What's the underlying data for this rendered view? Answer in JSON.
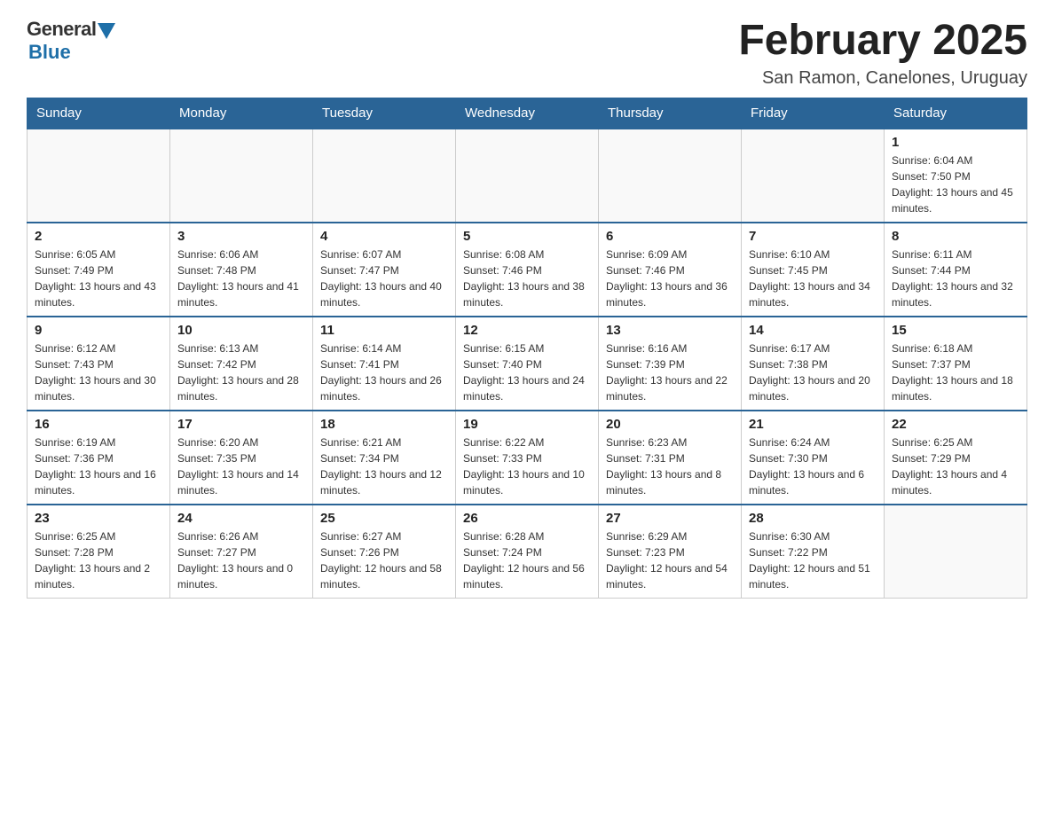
{
  "header": {
    "logo_general": "General",
    "logo_blue": "Blue",
    "title": "February 2025",
    "location": "San Ramon, Canelones, Uruguay"
  },
  "days_of_week": [
    "Sunday",
    "Monday",
    "Tuesday",
    "Wednesday",
    "Thursday",
    "Friday",
    "Saturday"
  ],
  "weeks": [
    [
      {
        "day": "",
        "info": ""
      },
      {
        "day": "",
        "info": ""
      },
      {
        "day": "",
        "info": ""
      },
      {
        "day": "",
        "info": ""
      },
      {
        "day": "",
        "info": ""
      },
      {
        "day": "",
        "info": ""
      },
      {
        "day": "1",
        "info": "Sunrise: 6:04 AM\nSunset: 7:50 PM\nDaylight: 13 hours and 45 minutes."
      }
    ],
    [
      {
        "day": "2",
        "info": "Sunrise: 6:05 AM\nSunset: 7:49 PM\nDaylight: 13 hours and 43 minutes."
      },
      {
        "day": "3",
        "info": "Sunrise: 6:06 AM\nSunset: 7:48 PM\nDaylight: 13 hours and 41 minutes."
      },
      {
        "day": "4",
        "info": "Sunrise: 6:07 AM\nSunset: 7:47 PM\nDaylight: 13 hours and 40 minutes."
      },
      {
        "day": "5",
        "info": "Sunrise: 6:08 AM\nSunset: 7:46 PM\nDaylight: 13 hours and 38 minutes."
      },
      {
        "day": "6",
        "info": "Sunrise: 6:09 AM\nSunset: 7:46 PM\nDaylight: 13 hours and 36 minutes."
      },
      {
        "day": "7",
        "info": "Sunrise: 6:10 AM\nSunset: 7:45 PM\nDaylight: 13 hours and 34 minutes."
      },
      {
        "day": "8",
        "info": "Sunrise: 6:11 AM\nSunset: 7:44 PM\nDaylight: 13 hours and 32 minutes."
      }
    ],
    [
      {
        "day": "9",
        "info": "Sunrise: 6:12 AM\nSunset: 7:43 PM\nDaylight: 13 hours and 30 minutes."
      },
      {
        "day": "10",
        "info": "Sunrise: 6:13 AM\nSunset: 7:42 PM\nDaylight: 13 hours and 28 minutes."
      },
      {
        "day": "11",
        "info": "Sunrise: 6:14 AM\nSunset: 7:41 PM\nDaylight: 13 hours and 26 minutes."
      },
      {
        "day": "12",
        "info": "Sunrise: 6:15 AM\nSunset: 7:40 PM\nDaylight: 13 hours and 24 minutes."
      },
      {
        "day": "13",
        "info": "Sunrise: 6:16 AM\nSunset: 7:39 PM\nDaylight: 13 hours and 22 minutes."
      },
      {
        "day": "14",
        "info": "Sunrise: 6:17 AM\nSunset: 7:38 PM\nDaylight: 13 hours and 20 minutes."
      },
      {
        "day": "15",
        "info": "Sunrise: 6:18 AM\nSunset: 7:37 PM\nDaylight: 13 hours and 18 minutes."
      }
    ],
    [
      {
        "day": "16",
        "info": "Sunrise: 6:19 AM\nSunset: 7:36 PM\nDaylight: 13 hours and 16 minutes."
      },
      {
        "day": "17",
        "info": "Sunrise: 6:20 AM\nSunset: 7:35 PM\nDaylight: 13 hours and 14 minutes."
      },
      {
        "day": "18",
        "info": "Sunrise: 6:21 AM\nSunset: 7:34 PM\nDaylight: 13 hours and 12 minutes."
      },
      {
        "day": "19",
        "info": "Sunrise: 6:22 AM\nSunset: 7:33 PM\nDaylight: 13 hours and 10 minutes."
      },
      {
        "day": "20",
        "info": "Sunrise: 6:23 AM\nSunset: 7:31 PM\nDaylight: 13 hours and 8 minutes."
      },
      {
        "day": "21",
        "info": "Sunrise: 6:24 AM\nSunset: 7:30 PM\nDaylight: 13 hours and 6 minutes."
      },
      {
        "day": "22",
        "info": "Sunrise: 6:25 AM\nSunset: 7:29 PM\nDaylight: 13 hours and 4 minutes."
      }
    ],
    [
      {
        "day": "23",
        "info": "Sunrise: 6:25 AM\nSunset: 7:28 PM\nDaylight: 13 hours and 2 minutes."
      },
      {
        "day": "24",
        "info": "Sunrise: 6:26 AM\nSunset: 7:27 PM\nDaylight: 13 hours and 0 minutes."
      },
      {
        "day": "25",
        "info": "Sunrise: 6:27 AM\nSunset: 7:26 PM\nDaylight: 12 hours and 58 minutes."
      },
      {
        "day": "26",
        "info": "Sunrise: 6:28 AM\nSunset: 7:24 PM\nDaylight: 12 hours and 56 minutes."
      },
      {
        "day": "27",
        "info": "Sunrise: 6:29 AM\nSunset: 7:23 PM\nDaylight: 12 hours and 54 minutes."
      },
      {
        "day": "28",
        "info": "Sunrise: 6:30 AM\nSunset: 7:22 PM\nDaylight: 12 hours and 51 minutes."
      },
      {
        "day": "",
        "info": ""
      }
    ]
  ]
}
